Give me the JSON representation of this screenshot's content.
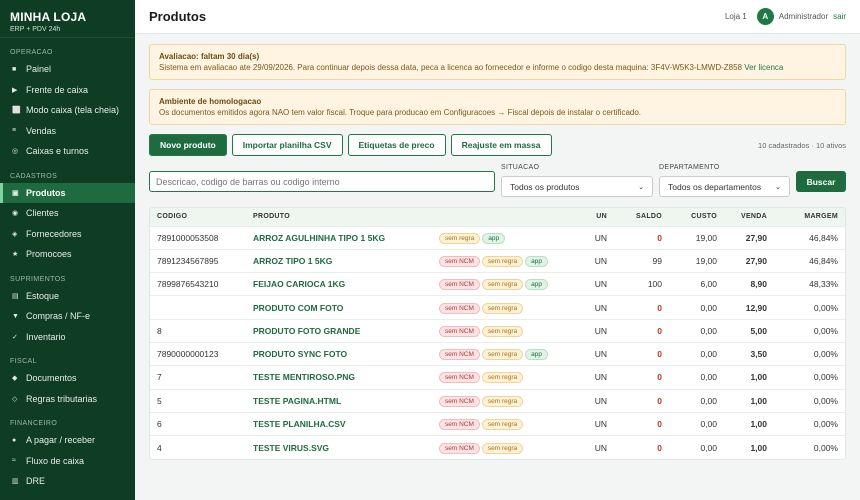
{
  "brand": {
    "title": "MINHA LOJA",
    "subtitle": "ERP + PDV 24h"
  },
  "sidebar": {
    "sections": [
      {
        "label": "OPERACAO",
        "items": [
          {
            "label": "Painel",
            "icon": "square-icon",
            "glyph": "■"
          },
          {
            "label": "Frente de caixa",
            "icon": "play-icon",
            "glyph": "▶"
          },
          {
            "label": "Modo caixa (tela cheia)",
            "icon": "fullscreen-icon",
            "glyph": "⬜"
          },
          {
            "label": "Vendas",
            "icon": "list-icon",
            "glyph": "≡"
          },
          {
            "label": "Caixas e turnos",
            "icon": "target-icon",
            "glyph": "◎"
          }
        ]
      },
      {
        "label": "CADASTROS",
        "items": [
          {
            "label": "Produtos",
            "icon": "box-icon",
            "glyph": "▣",
            "active": true
          },
          {
            "label": "Clientes",
            "icon": "user-icon",
            "glyph": "◉"
          },
          {
            "label": "Fornecedores",
            "icon": "diamond-icon",
            "glyph": "◈"
          },
          {
            "label": "Promocoes",
            "icon": "star-icon",
            "glyph": "★"
          }
        ]
      },
      {
        "label": "SUPRIMENTOS",
        "items": [
          {
            "label": "Estoque",
            "icon": "stock-icon",
            "glyph": "▤"
          },
          {
            "label": "Compras / NF-e",
            "icon": "down-triangle-icon",
            "glyph": "▼"
          },
          {
            "label": "Inventario",
            "icon": "check-icon",
            "glyph": "✓"
          }
        ]
      },
      {
        "label": "FISCAL",
        "items": [
          {
            "label": "Documentos",
            "icon": "diamond-filled-icon",
            "glyph": "◆"
          },
          {
            "label": "Regras tributarias",
            "icon": "diamond-outline-icon",
            "glyph": "◇"
          }
        ]
      },
      {
        "label": "FINANCEIRO",
        "items": [
          {
            "label": "A pagar / receber",
            "icon": "dot-icon",
            "glyph": "●"
          },
          {
            "label": "Fluxo de caixa",
            "icon": "approx-icon",
            "glyph": "≈"
          },
          {
            "label": "DRE",
            "icon": "report-icon",
            "glyph": "▥"
          }
        ]
      }
    ]
  },
  "header": {
    "title": "Produtos",
    "store": "Loja 1",
    "avatar_letter": "A",
    "user": "Administrador",
    "logout": "sair"
  },
  "alerts": {
    "trial": {
      "title": "Avaliacao: faltam 30 dia(s)",
      "text": "Sistema em avaliacao ate 29/09/2026. Para continuar depois dessa data, peca a licenca ao fornecedor e informe o codigo desta maquina: 3F4V-W5K3-LMWD-Z858",
      "link": "Ver licenca"
    },
    "homolog": {
      "title": "Ambiente de homologacao",
      "text": "Os documentos emitidos agora NAO tem valor fiscal. Troque para producao em Configuracoes → Fiscal depois de instalar o certificado."
    }
  },
  "actions": {
    "new": "Novo produto",
    "import": "Importar planilha CSV",
    "labels": "Etiquetas de preco",
    "adjust": "Reajuste em massa",
    "count": "10 cadastrados · 10 ativos"
  },
  "filters": {
    "search_placeholder": "Descricao, codigo de barras ou codigo interno",
    "situacao_label": "SITUACAO",
    "situacao_value": "Todos os produtos",
    "departamento_label": "DEPARTAMENTO",
    "departamento_value": "Todos os departamentos",
    "search_button": "Buscar"
  },
  "table": {
    "headers": {
      "codigo": "CODIGO",
      "produto": "PRODUTO",
      "un": "UN",
      "saldo": "SALDO",
      "custo": "CUSTO",
      "venda": "VENDA",
      "margem": "MARGEM"
    },
    "rows": [
      {
        "codigo": "7891000053508",
        "produto": "ARROZ AGULHINHA TIPO 1 5KG",
        "tags": [
          "sem regra",
          "app"
        ],
        "un": "UN",
        "saldo": "0",
        "custo": "19,00",
        "venda": "27,90",
        "margem": "46,84%"
      },
      {
        "codigo": "7891234567895",
        "produto": "ARROZ TIPO 1 5KG",
        "tags": [
          "sem NCM",
          "sem regra",
          "app"
        ],
        "un": "UN",
        "saldo": "99",
        "custo": "19,00",
        "venda": "27,90",
        "margem": "46,84%"
      },
      {
        "codigo": "7899876543210",
        "produto": "FEIJAO CARIOCA 1KG",
        "tags": [
          "sem NCM",
          "sem regra",
          "app"
        ],
        "un": "UN",
        "saldo": "100",
        "custo": "6,00",
        "venda": "8,90",
        "margem": "48,33%"
      },
      {
        "codigo": "",
        "produto": "PRODUTO COM FOTO",
        "tags": [
          "sem NCM",
          "sem regra"
        ],
        "un": "UN",
        "saldo": "0",
        "custo": "0,00",
        "venda": "12,90",
        "margem": "0,00%"
      },
      {
        "codigo": "8",
        "produto": "PRODUTO FOTO GRANDE",
        "tags": [
          "sem NCM",
          "sem regra"
        ],
        "un": "UN",
        "saldo": "0",
        "custo": "0,00",
        "venda": "5,00",
        "margem": "0,00%"
      },
      {
        "codigo": "7890000000123",
        "produto": "PRODUTO SYNC FOTO",
        "tags": [
          "sem NCM",
          "sem regra",
          "app"
        ],
        "un": "UN",
        "saldo": "0",
        "custo": "0,00",
        "venda": "3,50",
        "margem": "0,00%"
      },
      {
        "codigo": "7",
        "produto": "TESTE MENTIROSO.PNG",
        "tags": [
          "sem NCM",
          "sem regra"
        ],
        "un": "UN",
        "saldo": "0",
        "custo": "0,00",
        "venda": "1,00",
        "margem": "0,00%"
      },
      {
        "codigo": "5",
        "produto": "TESTE PAGINA.HTML",
        "tags": [
          "sem NCM",
          "sem regra"
        ],
        "un": "UN",
        "saldo": "0",
        "custo": "0,00",
        "venda": "1,00",
        "margem": "0,00%"
      },
      {
        "codigo": "6",
        "produto": "TESTE PLANILHA.CSV",
        "tags": [
          "sem NCM",
          "sem regra"
        ],
        "un": "UN",
        "saldo": "0",
        "custo": "0,00",
        "venda": "1,00",
        "margem": "0,00%"
      },
      {
        "codigo": "4",
        "produto": "TESTE VIRUS.SVG",
        "tags": [
          "sem NCM",
          "sem regra"
        ],
        "un": "UN",
        "saldo": "0",
        "custo": "0,00",
        "venda": "1,00",
        "margem": "0,00%"
      }
    ]
  },
  "colors": {
    "sidebar_bg": "#0f3d24",
    "accent": "#1e6b3f",
    "danger": "#c0392b",
    "alert_bg": "#fff4e2"
  }
}
